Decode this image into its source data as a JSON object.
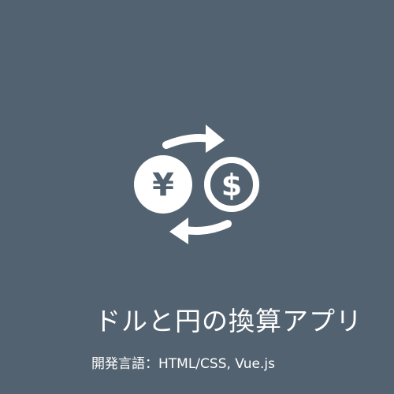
{
  "app": {
    "title": "ドルと円の換算アプリ",
    "dev_language_label": "開発言語",
    "dev_language_separator": "：",
    "dev_language_value": "HTML/CSS, Vue.js"
  },
  "logo": {
    "icon": "currency-exchange-icon",
    "yen_symbol": "¥",
    "dollar_symbol": "$"
  },
  "colors": {
    "background": "#536270",
    "foreground": "#ffffff"
  }
}
